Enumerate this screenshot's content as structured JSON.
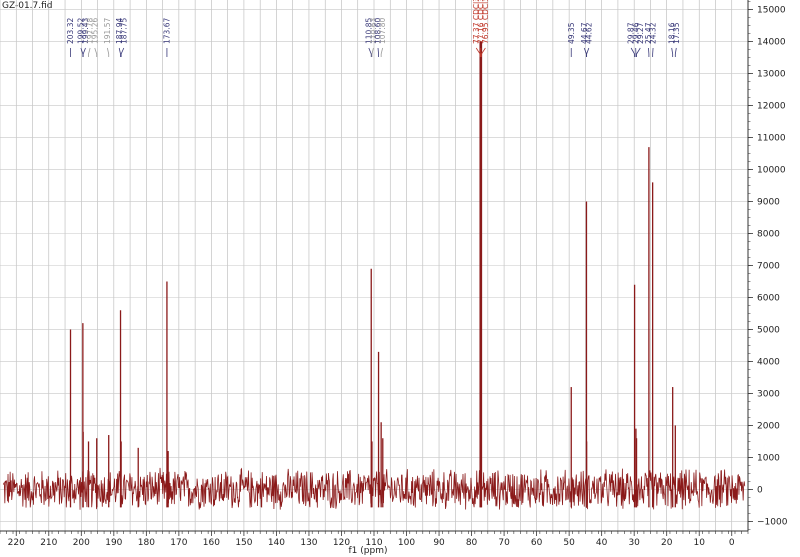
{
  "title": "GZ-01.7.fid",
  "chart_data": {
    "type": "line",
    "title": "GZ-01.7.fid",
    "xlabel": "f1 (ppm)",
    "ylabel": "",
    "xlim": [
      225,
      -5
    ],
    "ylim": [
      -1300,
      15300
    ],
    "x_ticks": [
      220,
      210,
      200,
      190,
      180,
      170,
      160,
      150,
      140,
      130,
      120,
      110,
      100,
      90,
      80,
      70,
      60,
      50,
      40,
      30,
      20,
      10,
      0
    ],
    "y_ticks": [
      -1000,
      0,
      1000,
      2000,
      3000,
      4000,
      5000,
      6000,
      7000,
      8000,
      9000,
      10000,
      11000,
      12000,
      13000,
      14000,
      15000
    ],
    "grid": true,
    "noise_amplitude": 700,
    "series": [
      {
        "color": "#8b1a1a",
        "peaks": [
          {
            "x": 203.32,
            "y": 5000
          },
          {
            "x": 199.52,
            "y": 5200
          },
          {
            "x": 199.43,
            "y": 1800
          },
          {
            "x": 197.78,
            "y": 1500
          },
          {
            "x": 195.26,
            "y": 1600
          },
          {
            "x": 191.57,
            "y": 1700
          },
          {
            "x": 187.94,
            "y": 5600
          },
          {
            "x": 187.75,
            "y": 1500
          },
          {
            "x": 182.5,
            "y": 1300
          },
          {
            "x": 173.67,
            "y": 6500
          },
          {
            "x": 173.3,
            "y": 1200
          },
          {
            "x": 110.85,
            "y": 6900
          },
          {
            "x": 110.63,
            "y": 1500
          },
          {
            "x": 108.6,
            "y": 4300
          },
          {
            "x": 107.8,
            "y": 2100
          },
          {
            "x": 107.3,
            "y": 1600
          },
          {
            "x": 77.37,
            "y": 14000
          },
          {
            "x": 77.16,
            "y": 14000
          },
          {
            "x": 76.95,
            "y": 14000
          },
          {
            "x": 49.35,
            "y": 3200
          },
          {
            "x": 44.67,
            "y": 9000
          },
          {
            "x": 44.62,
            "y": 1500
          },
          {
            "x": 29.87,
            "y": 6400
          },
          {
            "x": 29.46,
            "y": 1900
          },
          {
            "x": 29.27,
            "y": 1600
          },
          {
            "x": 25.47,
            "y": 10700
          },
          {
            "x": 24.32,
            "y": 9600
          },
          {
            "x": 18.16,
            "y": 3200
          },
          {
            "x": 17.35,
            "y": 2000
          }
        ]
      }
    ],
    "peak_labels": [
      {
        "text": "203.32",
        "x": 203.32,
        "color": "#3a3a7a"
      },
      {
        "text": "199.52",
        "x": 199.52,
        "color": "#3a3a7a"
      },
      {
        "text": "199.43",
        "x": 199.43,
        "color": "#3a3a7a"
      },
      {
        "text": "197.78",
        "x": 197.78,
        "color": "#9a9a9a"
      },
      {
        "text": "195.26",
        "x": 195.26,
        "color": "#9a9a9a"
      },
      {
        "text": "191.57",
        "x": 191.57,
        "color": "#9a9a9a"
      },
      {
        "text": "187.94",
        "x": 187.94,
        "color": "#3a3a7a"
      },
      {
        "text": "187.75",
        "x": 187.75,
        "color": "#3a3a7a"
      },
      {
        "text": "173.67",
        "x": 173.67,
        "color": "#3a3a7a"
      },
      {
        "text": "110.85",
        "x": 110.85,
        "color": "#3a3a7a"
      },
      {
        "text": "110.63",
        "x": 110.63,
        "color": "#9a9a9a"
      },
      {
        "text": "108.60",
        "x": 108.6,
        "color": "#3a3a7a"
      },
      {
        "text": "107.80",
        "x": 107.8,
        "color": "#9a9a9a"
      },
      {
        "text": "77.37 CDCl3",
        "x": 77.37,
        "color": "#c0392b"
      },
      {
        "text": "77.16 CDCl3",
        "x": 77.16,
        "color": "#c0392b"
      },
      {
        "text": "76.95 CDCl3",
        "x": 76.95,
        "color": "#c0392b"
      },
      {
        "text": "49.35",
        "x": 49.35,
        "color": "#3a3a7a"
      },
      {
        "text": "44.67",
        "x": 44.67,
        "color": "#3a3a7a"
      },
      {
        "text": "44.62",
        "x": 44.62,
        "color": "#3a3a7a"
      },
      {
        "text": "29.87",
        "x": 29.87,
        "color": "#3a3a7a"
      },
      {
        "text": "29.46",
        "x": 29.46,
        "color": "#3a3a7a"
      },
      {
        "text": "29.27",
        "x": 29.27,
        "color": "#3a3a7a"
      },
      {
        "text": "25.47",
        "x": 25.47,
        "color": "#3a3a7a"
      },
      {
        "text": "24.32",
        "x": 24.32,
        "color": "#3a3a7a"
      },
      {
        "text": "18.16",
        "x": 18.16,
        "color": "#3a3a7a"
      },
      {
        "text": "17.35",
        "x": 17.35,
        "color": "#3a3a7a"
      }
    ]
  }
}
